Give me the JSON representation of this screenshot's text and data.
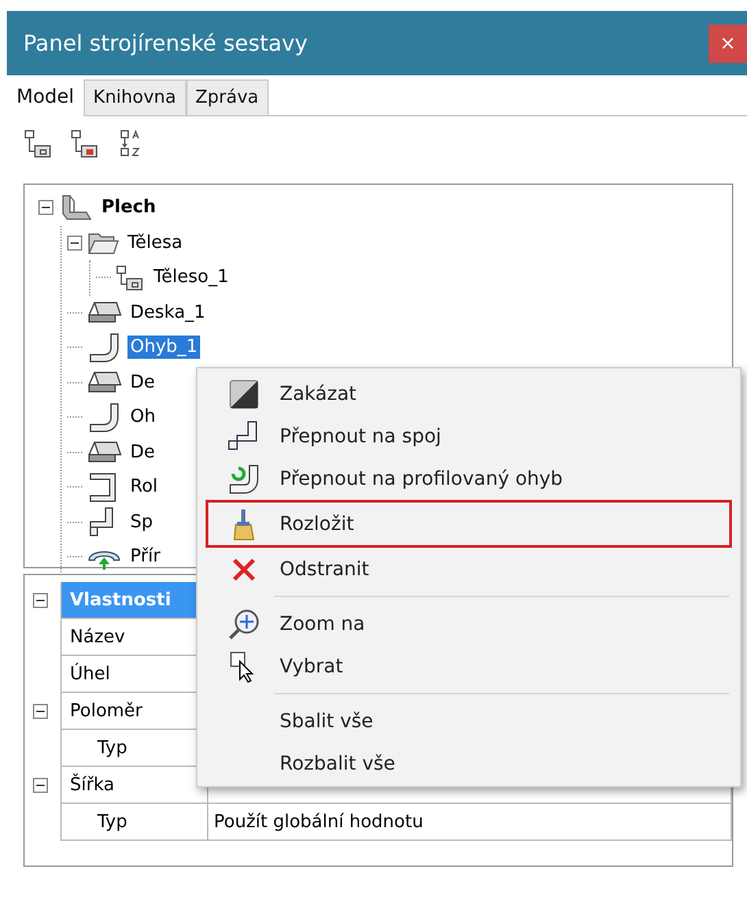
{
  "window": {
    "title": "Panel strojírenské sestavy",
    "close": "×"
  },
  "tabs": [
    {
      "label": "Model",
      "selected": true
    },
    {
      "label": "Knihovna",
      "selected": false
    },
    {
      "label": "Zpráva",
      "selected": false
    }
  ],
  "tree": [
    {
      "label": "Plech",
      "kind": "part",
      "bold": true,
      "expanded": true,
      "selected": false,
      "children": [
        {
          "label": "Tělesa",
          "kind": "folder",
          "expanded": true,
          "selected": false,
          "children": [
            {
              "label": "Těleso_1",
              "kind": "body",
              "selected": false
            }
          ]
        },
        {
          "label": "Deska_1",
          "kind": "plate",
          "selected": false
        },
        {
          "label": "Ohyb_1",
          "kind": "bend",
          "selected": true
        },
        {
          "label": "De",
          "kind": "plate",
          "selected": false
        },
        {
          "label": "Oh",
          "kind": "bend",
          "selected": false
        },
        {
          "label": "De",
          "kind": "plate",
          "selected": false
        },
        {
          "label": "Rol",
          "kind": "roll",
          "selected": false
        },
        {
          "label": "Sp",
          "kind": "joint",
          "selected": false
        },
        {
          "label": "Přír",
          "kind": "feature",
          "selected": false
        }
      ]
    }
  ],
  "properties": [
    {
      "label": "Vlastnosti",
      "kind": "category",
      "expanded": true,
      "selected": true,
      "children": [
        {
          "label": "Název"
        },
        {
          "label": "Úhel"
        }
      ]
    },
    {
      "label": "Poloměr",
      "kind": "property",
      "expanded": true,
      "selected": false,
      "children": [
        {
          "label": "Typ"
        }
      ]
    },
    {
      "label": "Šířka",
      "kind": "property",
      "expanded": true,
      "selected": false,
      "children": [
        {
          "label": "Typ",
          "value": "Použít globální hodnotu"
        }
      ]
    }
  ],
  "context_menu": [
    {
      "kind": "disable",
      "label": "Zakázat",
      "selected": false
    },
    {
      "kind": "switch-joint",
      "label": "Přepnout na spoj",
      "selected": false
    },
    {
      "kind": "switch-bend",
      "label": "Přepnout na profilovaný ohyb",
      "selected": false
    },
    {
      "kind": "unfold",
      "label": "Rozložit",
      "selected": true
    },
    {
      "kind": "delete",
      "label": "Odstranit",
      "selected": false
    },
    {
      "kind": "separator"
    },
    {
      "kind": "zoom",
      "label": "Zoom na",
      "selected": false
    },
    {
      "kind": "select",
      "label": "Vybrat",
      "selected": false
    },
    {
      "kind": "separator"
    },
    {
      "kind": "plain",
      "label": "Sbalit vše",
      "selected": false
    },
    {
      "kind": "plain",
      "label": "Rozbalit vše",
      "selected": false
    }
  ]
}
